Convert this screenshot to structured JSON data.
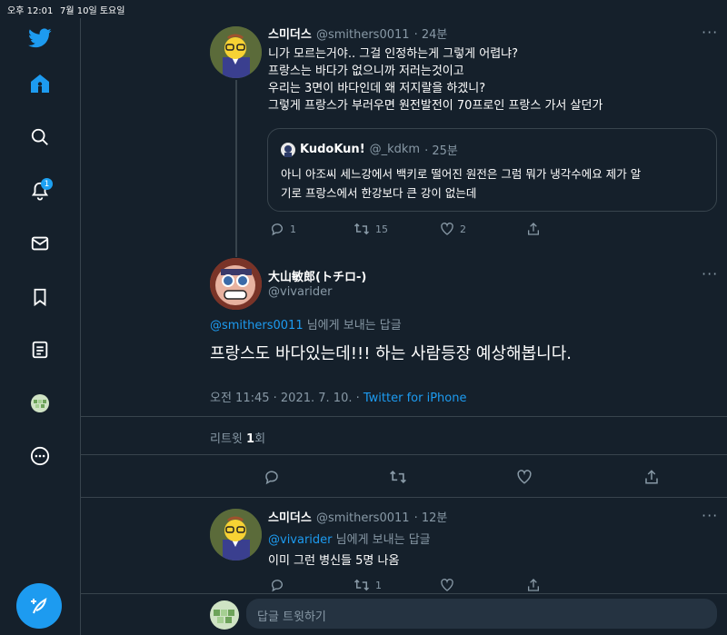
{
  "status_bar": {
    "time": "오후 12:01",
    "date": "7월 10일 토요일"
  },
  "sidebar": {
    "notification_count": "1",
    "items": [
      "twitter-logo",
      "home",
      "explore",
      "notifications",
      "messages",
      "bookmarks",
      "lists",
      "profile",
      "more"
    ]
  },
  "tweet1": {
    "name": "스미더스",
    "handle": "@smithers0011",
    "time": "· 24분",
    "lines": [
      "니가 모르는거야.. 그걸 인정하는게 그렇게 어렵냐?",
      "프랑스는 바다가 없으니까 저러는것이고",
      "우리는 3면이 바다인데 왜 저지랄을 하겠니?",
      "그렇게 프랑스가 부러우면 원전발전이 70프로인 프랑스 가서 살던가"
    ],
    "quote": {
      "name": "KudoKun!",
      "handle": "@_kdkm",
      "time": "· 25분",
      "lines": [
        "아니 아조씨 세느강에서 백키로 떨어진 원전은 그럼 뭐가 냉각수에요 제가 알",
        "기로 프랑스에서 한강보다 큰 강이 없는데"
      ]
    },
    "replies": "1",
    "retweets": "15",
    "likes": "2"
  },
  "main_tweet": {
    "name": "大山敏郎(トチロ-)",
    "handle": "@vivarider",
    "reply_to_handle": "@smithers0011",
    "reply_to_suffix": " 님에게 보내는 답글",
    "text": "프랑스도 바다있는데!!! 하는 사람등장 예상해봅니다.",
    "timestamp": "오전 11:45 · 2021. 7. 10. · ",
    "source": "Twitter for iPhone",
    "retweets_label": "리트윗 ",
    "retweets_count": "1",
    "retweets_suffix": "회"
  },
  "reply_tweet": {
    "name": "스미더스",
    "handle": "@smithers0011",
    "time": "· 12분",
    "reply_to_handle": "@vivarider",
    "reply_to_suffix": " 님에게 보내는 답글",
    "text": "이미 그런 병신들 5명 나옴",
    "replies": "",
    "retweets": "1",
    "likes": ""
  },
  "composer": {
    "placeholder": "답글 트윗하기"
  },
  "colors": {
    "background": "#15202b",
    "accent": "#1d9bf0",
    "muted": "#8899a6",
    "border": "#38444d"
  }
}
